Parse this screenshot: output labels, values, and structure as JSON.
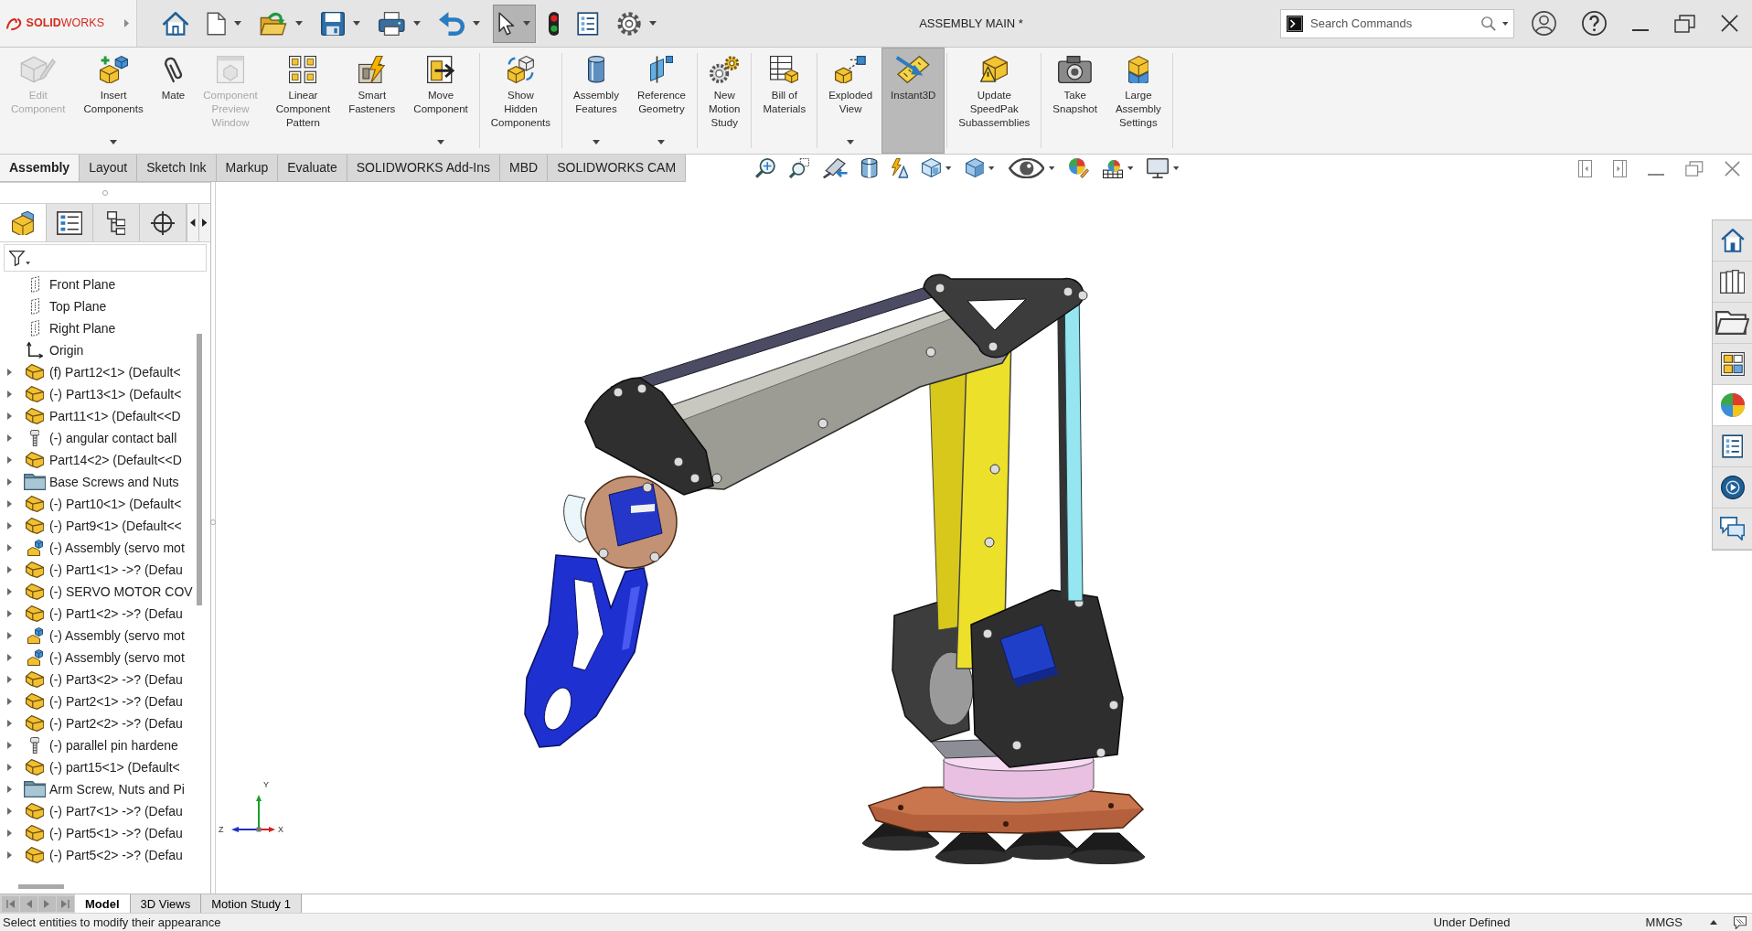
{
  "title_bar": {
    "logo": "**SOLID**WORKS",
    "title": "ASSEMBLY MAIN *",
    "search": {
      "placeholder": "Search Commands"
    }
  },
  "quick_access": [
    {
      "kind": "home",
      "dropdown": false,
      "pressed": false
    },
    {
      "kind": "new",
      "dropdown": true,
      "pressed": false
    },
    {
      "kind": "open",
      "dropdown": true,
      "pressed": false
    },
    {
      "kind": "save",
      "dropdown": true,
      "pressed": false
    },
    {
      "kind": "print",
      "dropdown": true,
      "pressed": false
    },
    {
      "kind": "undo",
      "dropdown": true,
      "pressed": false
    },
    {
      "kind": "select",
      "dropdown": true,
      "pressed": true
    },
    {
      "kind": "rebuild",
      "dropdown": false,
      "pressed": false
    },
    {
      "kind": "file-properties",
      "dropdown": false,
      "pressed": false
    },
    {
      "kind": "options",
      "dropdown": true,
      "pressed": false
    }
  ],
  "ribbon": {
    "groups": [
      {
        "buttons": [
          {
            "kind": "edit-component",
            "label": "Edit\nComponent",
            "disabled": true,
            "dropdown": false,
            "pressed": false
          },
          {
            "kind": "insert-components",
            "label": "Insert\nComponents",
            "disabled": false,
            "dropdown": true,
            "pressed": false
          },
          {
            "kind": "mate",
            "label": "Mate",
            "disabled": false,
            "dropdown": false,
            "pressed": false
          },
          {
            "kind": "preview-window",
            "label": "Component\nPreview\nWindow",
            "disabled": true,
            "dropdown": false,
            "pressed": false
          },
          {
            "kind": "linear-pattern",
            "label": "Linear\nComponent\nPattern",
            "disabled": false,
            "dropdown": false,
            "pressed": false
          },
          {
            "kind": "smart-fasteners",
            "label": "Smart\nFasteners",
            "disabled": false,
            "dropdown": false,
            "pressed": false
          },
          {
            "kind": "move-component",
            "label": "Move\nComponent",
            "disabled": false,
            "dropdown": true,
            "pressed": false
          }
        ]
      },
      {
        "buttons": [
          {
            "kind": "show-hidden",
            "label": "Show\nHidden\nComponents",
            "disabled": false,
            "dropdown": false,
            "pressed": false
          }
        ]
      },
      {
        "buttons": [
          {
            "kind": "assembly-features",
            "label": "Assembly\nFeatures",
            "disabled": false,
            "dropdown": true,
            "pressed": false
          },
          {
            "kind": "reference-geometry",
            "label": "Reference\nGeometry",
            "disabled": false,
            "dropdown": true,
            "pressed": false
          }
        ]
      },
      {
        "buttons": [
          {
            "kind": "motion-study",
            "label": "New\nMotion\nStudy",
            "disabled": false,
            "dropdown": false,
            "pressed": false
          }
        ]
      },
      {
        "buttons": [
          {
            "kind": "bill-of-materials",
            "label": "Bill of\nMaterials",
            "disabled": false,
            "dropdown": false,
            "pressed": false
          }
        ]
      },
      {
        "buttons": [
          {
            "kind": "exploded-view",
            "label": "Exploded\nView",
            "disabled": false,
            "dropdown": true,
            "pressed": false
          },
          {
            "kind": "instant3d",
            "label": "Instant3D",
            "disabled": false,
            "dropdown": false,
            "pressed": true
          }
        ]
      },
      {
        "buttons": [
          {
            "kind": "speedpak",
            "label": "Update\nSpeedPak\nSubassemblies",
            "disabled": false,
            "dropdown": false,
            "pressed": false
          }
        ]
      },
      {
        "buttons": [
          {
            "kind": "snapshot",
            "label": "Take\nSnapshot",
            "disabled": false,
            "dropdown": false,
            "pressed": false
          },
          {
            "kind": "large-assembly",
            "label": "Large\nAssembly\nSettings",
            "disabled": false,
            "dropdown": false,
            "pressed": false
          }
        ]
      }
    ]
  },
  "command_tabs": [
    {
      "label": "Assembly",
      "selected": true
    },
    {
      "label": "Layout",
      "selected": false
    },
    {
      "label": "Sketch Ink",
      "selected": false
    },
    {
      "label": "Markup",
      "selected": false
    },
    {
      "label": "Evaluate",
      "selected": false
    },
    {
      "label": "SOLIDWORKS Add-Ins",
      "selected": false
    },
    {
      "label": "MBD",
      "selected": false
    },
    {
      "label": "SOLIDWORKS CAM",
      "selected": false
    }
  ],
  "view_toolbar": [
    {
      "kind": "zoom-to-fit",
      "dropdown": false
    },
    {
      "kind": "zoom-to-area",
      "dropdown": false
    },
    {
      "kind": "previous-view",
      "dropdown": false
    },
    {
      "kind": "section-view",
      "dropdown": false
    },
    {
      "kind": "dynamic-annotation",
      "dropdown": false
    },
    {
      "kind": "view-orientation",
      "dropdown": true
    },
    {
      "kind": "display-style",
      "dropdown": true
    },
    {
      "kind": "hide-show",
      "dropdown": true
    },
    {
      "kind": "edit-appearance",
      "dropdown": false
    },
    {
      "kind": "scene",
      "dropdown": true
    },
    {
      "kind": "view-settings",
      "dropdown": true
    }
  ],
  "feature_tree": {
    "tabs": [
      {
        "kind": "feature-manager",
        "selected": true
      },
      {
        "kind": "property-manager",
        "selected": false
      },
      {
        "kind": "configuration-manager",
        "selected": false
      },
      {
        "kind": "dimxpert",
        "selected": false
      }
    ],
    "items": [
      {
        "label": "Front Plane",
        "kind": "plane"
      },
      {
        "label": "Top Plane",
        "kind": "plane"
      },
      {
        "label": "Right Plane",
        "kind": "plane"
      },
      {
        "label": "Origin",
        "kind": "origin"
      },
      {
        "label": "(f) Part12<1> (Default<",
        "kind": "part",
        "expanded": false
      },
      {
        "label": "(-) Part13<1> (Default<",
        "kind": "part",
        "expanded": false
      },
      {
        "label": "Part11<1> (Default<<D",
        "kind": "part",
        "expanded": false
      },
      {
        "label": "(-) angular contact ball",
        "kind": "fastener",
        "expanded": false
      },
      {
        "label": "Part14<2> (Default<<D",
        "kind": "part",
        "expanded": false
      },
      {
        "label": "Base Screws and Nuts",
        "kind": "folder",
        "expanded": false
      },
      {
        "label": "(-) Part10<1> (Default<",
        "kind": "part",
        "expanded": false
      },
      {
        "label": "(-) Part9<1> (Default<<",
        "kind": "part",
        "expanded": false
      },
      {
        "label": "(-) Assembly (servo mot",
        "kind": "subassembly",
        "expanded": false
      },
      {
        "label": "(-) Part1<1> ->? (Defau",
        "kind": "part",
        "expanded": false
      },
      {
        "label": "(-) SERVO MOTOR COV",
        "kind": "part",
        "expanded": false
      },
      {
        "label": "(-) Part1<2> ->? (Defau",
        "kind": "part",
        "expanded": false
      },
      {
        "label": "(-) Assembly (servo mot",
        "kind": "subassembly",
        "expanded": false
      },
      {
        "label": "(-) Assembly (servo mot",
        "kind": "subassembly",
        "expanded": false
      },
      {
        "label": "(-) Part3<2> ->? (Defau",
        "kind": "part",
        "expanded": false
      },
      {
        "label": "(-) Part2<1> ->? (Defau",
        "kind": "part",
        "expanded": false
      },
      {
        "label": "(-) Part2<2> ->? (Defau",
        "kind": "part",
        "expanded": false
      },
      {
        "label": "(-) parallel pin hardene",
        "kind": "fastener",
        "expanded": false
      },
      {
        "label": "(-) part15<1> (Default<",
        "kind": "part",
        "expanded": false
      },
      {
        "label": "Arm Screw, Nuts and Pi",
        "kind": "folder",
        "expanded": false
      },
      {
        "label": "(-) Part7<1> ->? (Defau",
        "kind": "part",
        "expanded": false
      },
      {
        "label": "(-) Part5<1> ->? (Defau",
        "kind": "part",
        "expanded": false
      },
      {
        "label": "(-) Part5<2> ->? (Defau",
        "kind": "part",
        "expanded": false
      }
    ]
  },
  "graphics": {
    "triad": {
      "x_label": "X",
      "y_label": "Y",
      "z_label": "Z"
    }
  },
  "task_pane": [
    {
      "kind": "resources",
      "selected": false
    },
    {
      "kind": "design-library",
      "selected": false
    },
    {
      "kind": "file-explorer",
      "selected": false
    },
    {
      "kind": "view-palette",
      "selected": false
    },
    {
      "kind": "appearances",
      "selected": true
    },
    {
      "kind": "custom-properties",
      "selected": false
    },
    {
      "kind": "forum",
      "selected": false
    },
    {
      "kind": "discuss",
      "selected": false
    }
  ],
  "bottom_tabs": [
    {
      "label": "Model",
      "selected": true
    },
    {
      "label": "3D Views",
      "selected": false
    },
    {
      "label": "Motion Study 1",
      "selected": false
    }
  ],
  "status_bar": {
    "message": "Select entities to modify their appearance",
    "state": "Under Defined",
    "units": "MMGS"
  }
}
